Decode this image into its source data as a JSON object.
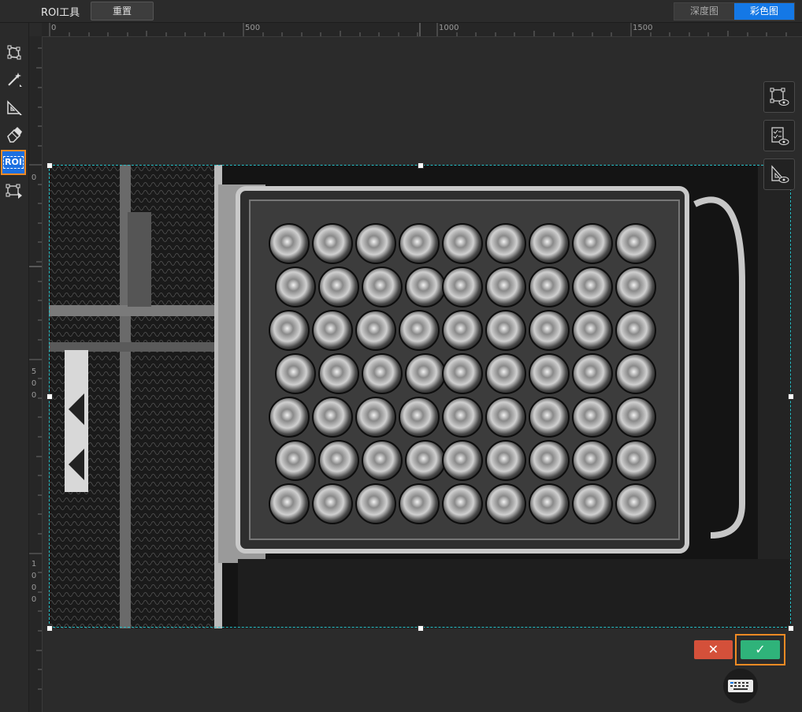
{
  "toolbar": {
    "title": "ROI工具",
    "reset_label": "重置",
    "view_tabs": [
      "深度图",
      "彩色图"
    ],
    "active_tab": "彩色图"
  },
  "tools": [
    {
      "name": "polygon-tool",
      "icon": "polygon-icon"
    },
    {
      "name": "magic-wand-tool",
      "icon": "magic-wand-icon"
    },
    {
      "name": "set-square-tool",
      "icon": "set-square-icon"
    },
    {
      "name": "eraser-tool",
      "icon": "eraser-icon"
    },
    {
      "name": "roi-tool",
      "icon": "roi-icon",
      "label": "ROI",
      "active": true
    },
    {
      "name": "roi-play-tool",
      "icon": "roi-play-icon"
    }
  ],
  "ruler": {
    "top_labels": [
      "0",
      "500",
      "1000",
      "1500"
    ],
    "left_labels": [
      "0",
      "500",
      "1000"
    ]
  },
  "side_buttons": [
    "polygon-view-icon",
    "checklist-view-icon",
    "set-square-view-icon"
  ],
  "actions": {
    "cancel": "✕",
    "confirm": "✓"
  },
  "colors": {
    "accent": "#1478e6",
    "highlight": "#f08a24",
    "cancel": "#d4503a",
    "confirm": "#2fb37a",
    "roi_border": "#27c0c8"
  }
}
